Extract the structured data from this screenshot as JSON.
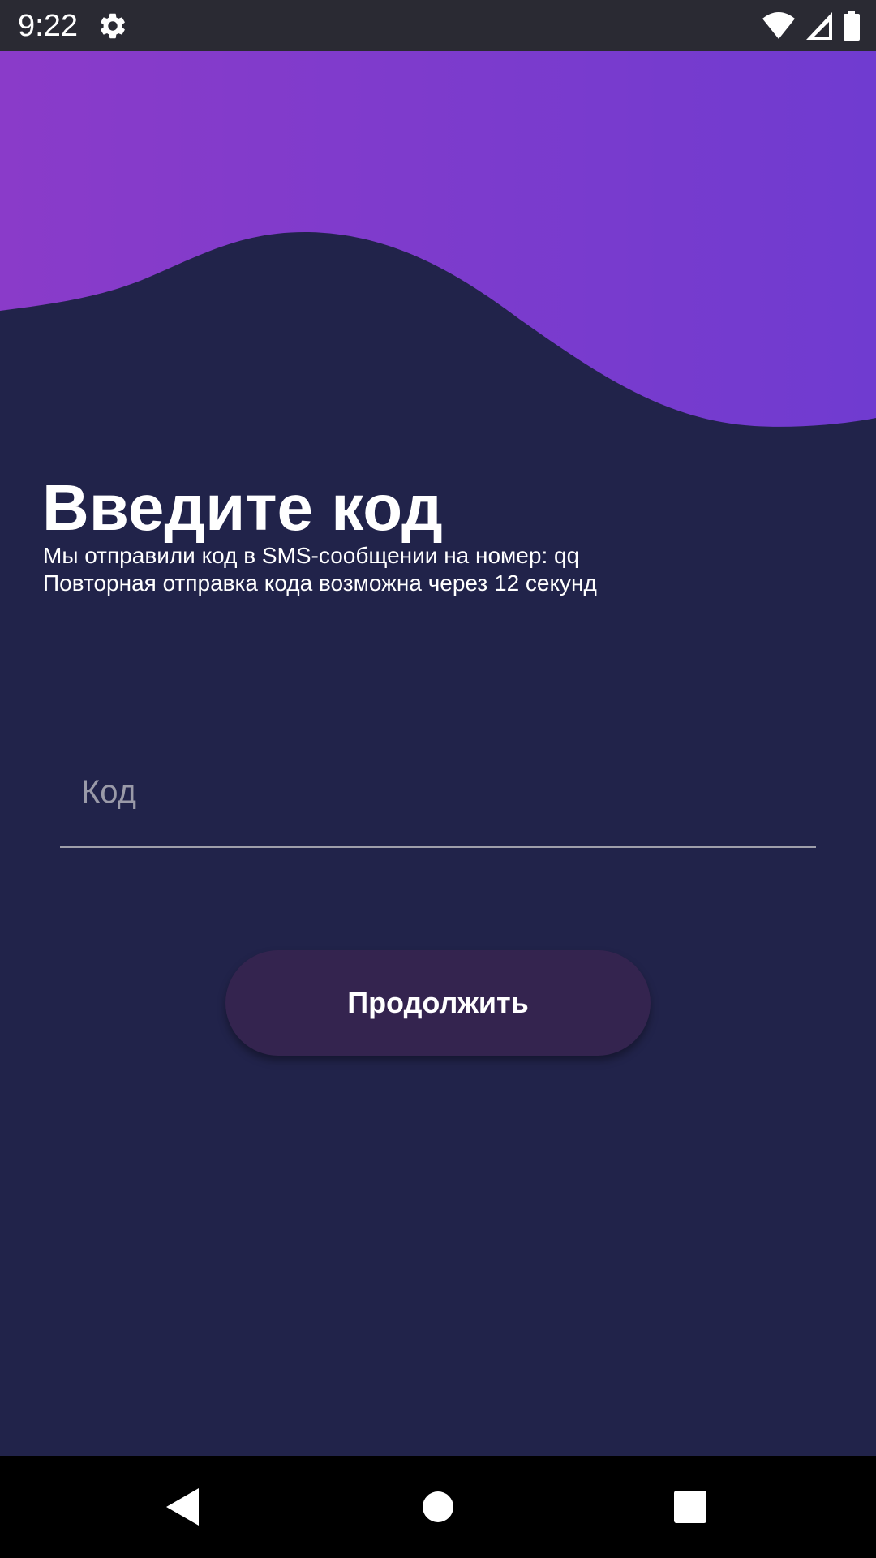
{
  "status_bar": {
    "time": "9:22",
    "icons": [
      "gear-icon",
      "wifi-icon",
      "signal-icon",
      "battery-icon"
    ]
  },
  "header": {
    "colors": {
      "wave_left": "#8a3bc9",
      "wave_right": "#703bd0",
      "background": "#21234a"
    }
  },
  "main": {
    "title": "Введите код",
    "subtitle_line1": "Мы отправили код в SMS-сообщении на номер: qq",
    "subtitle_line2": "Повторная отправка кода возможна через 12 секунд",
    "code_field": {
      "placeholder": "Код",
      "value": ""
    },
    "continue_label": "Продолжить"
  },
  "nav_bar": {
    "icons": [
      "back-icon",
      "home-icon",
      "recents-icon"
    ]
  }
}
